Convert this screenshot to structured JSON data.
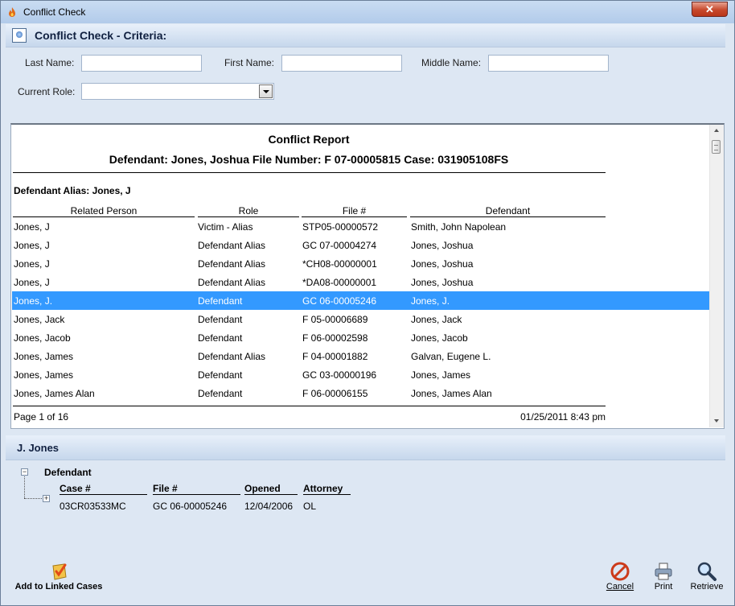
{
  "window": {
    "title": "Conflict Check",
    "close_label": "✕"
  },
  "criteria": {
    "header": "Conflict Check - Criteria:",
    "last_name_label": "Last Name:",
    "first_name_label": "First Name:",
    "middle_name_label": "Middle Name:",
    "current_role_label": "Current Role:",
    "last_name_value": "",
    "first_name_value": "",
    "middle_name_value": "",
    "current_role_value": ""
  },
  "report": {
    "title": "Conflict Report",
    "subtitle": "Defendant: Jones, Joshua  File Number: F  07-00005815  Case: 031905108FS",
    "alias_line": "Defendant Alias:  Jones, J",
    "columns": [
      "Related Person",
      "Role",
      "File #",
      "Defendant"
    ],
    "rows": [
      [
        "Jones, J",
        "Victim -  Alias",
        "STP05-00000572",
        "Smith, John Napolean"
      ],
      [
        "Jones, J",
        "Defendant Alias",
        "GC 07-00004274",
        "Jones, Joshua"
      ],
      [
        "Jones, J",
        "Defendant Alias",
        "*CH08-00000001",
        "Jones, Joshua"
      ],
      [
        "Jones, J",
        "Defendant Alias",
        "*DA08-00000001",
        "Jones, Joshua"
      ],
      [
        "Jones, J.",
        "Defendant",
        "GC 06-00005246",
        "Jones, J."
      ],
      [
        "Jones, Jack",
        "Defendant",
        "F  05-00006689",
        "Jones, Jack"
      ],
      [
        "Jones, Jacob",
        "Defendant",
        "F  06-00002598",
        "Jones, Jacob"
      ],
      [
        "Jones, James",
        "Defendant Alias",
        "F  04-00001882",
        "Galvan, Eugene L."
      ],
      [
        "Jones, James",
        "Defendant",
        "GC 03-00000196",
        "Jones, James"
      ],
      [
        "Jones, James Alan",
        "Defendant",
        "F  06-00006155",
        "Jones, James Alan"
      ]
    ],
    "selected_row": 4,
    "page_info": "Page 1 of 16",
    "timestamp": "01/25/2011 8:43 pm"
  },
  "detail": {
    "header": "J. Jones",
    "group_label": "Defendant",
    "columns": [
      "Case #",
      "File #",
      "Opened",
      "Attorney"
    ],
    "row": [
      "03CR03533MC",
      "GC 06-00005246",
      "12/04/2006",
      "OL"
    ]
  },
  "toolbar": {
    "add_linked": "Add to Linked Cases",
    "cancel": "Cancel",
    "print": "Print",
    "retrieve": "Retrieve"
  },
  "colors": {
    "selection": "#3399ff",
    "header_text": "#102040"
  }
}
